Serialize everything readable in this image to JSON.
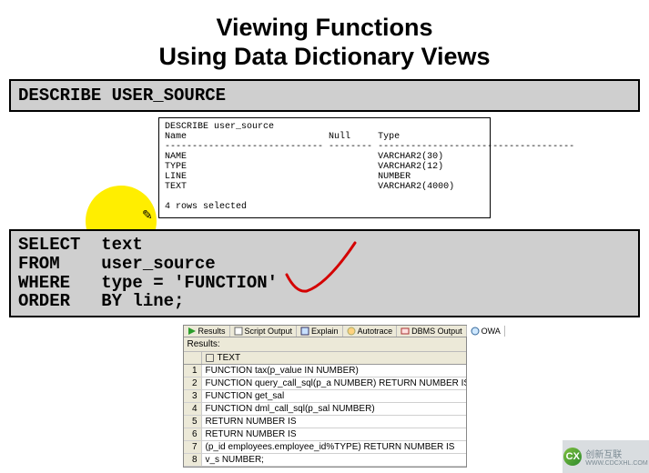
{
  "title": {
    "line1": "Viewing Functions",
    "line2": "Using Data Dictionary Views"
  },
  "describe_box": "DESCRIBE USER_SOURCE",
  "describe_output": {
    "header": "DESCRIBE user_source",
    "col_name": "Name",
    "col_null": "Null",
    "col_type": "Type",
    "sep1": "-----------------------------",
    "sep2": "--------",
    "sep3": "------------------------------------",
    "rows": [
      {
        "name": "NAME",
        "type": "VARCHAR2(30)"
      },
      {
        "name": "TYPE",
        "type": "VARCHAR2(12)"
      },
      {
        "name": "LINE",
        "type": "NUMBER"
      },
      {
        "name": "TEXT",
        "type": "VARCHAR2(4000)"
      }
    ],
    "footer": "4 rows selected"
  },
  "select_block": {
    "l1a": "SELECT  ",
    "l1b": "text",
    "l2": "FROM    user_source",
    "l3": "WHERE   type = 'FUNCTION'",
    "l4": "ORDER   BY line;"
  },
  "results": {
    "tabs": [
      "Results",
      "Script Output",
      "Explain",
      "Autotrace",
      "DBMS Output",
      "OWA"
    ],
    "label": "Results:",
    "col_header": "TEXT",
    "rows": [
      "FUNCTION tax(p_value IN NUMBER)",
      "FUNCTION query_call_sql(p_a NUMBER) RETURN NUMBER IS",
      "FUNCTION get_sal",
      "FUNCTION dml_call_sql(p_sal NUMBER)",
      "  RETURN NUMBER IS",
      "  RETURN NUMBER IS",
      " (p_id  employees.employee_id%TYPE) RETURN NUMBER IS",
      "  v_s NUMBER;"
    ]
  },
  "watermark": {
    "brand": "创新互联",
    "url": "WWW.CDCXHL.COM",
    "logo": "CX"
  }
}
